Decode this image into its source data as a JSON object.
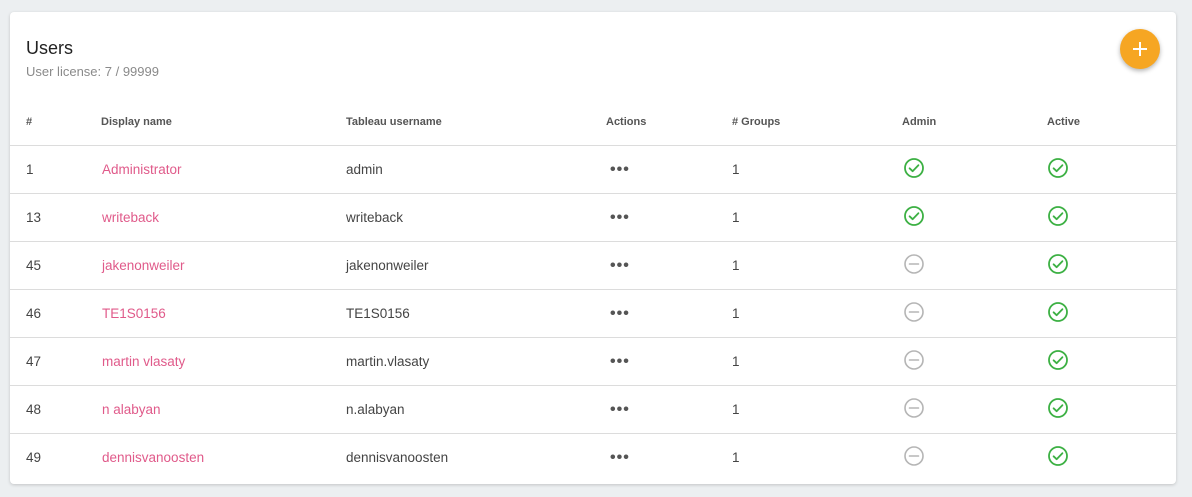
{
  "header": {
    "title": "Users",
    "license_text": "User license: 7 / 99999"
  },
  "columns": [
    "#",
    "Display name",
    "Tableau username",
    "Actions",
    "# Groups",
    "Admin",
    "Active"
  ],
  "rows": [
    {
      "id": "1",
      "display_name": "Administrator",
      "username": "admin",
      "actions": "•••",
      "groups": "1",
      "admin": true,
      "active": true
    },
    {
      "id": "13",
      "display_name": "writeback",
      "username": "writeback",
      "actions": "•••",
      "groups": "1",
      "admin": true,
      "active": true
    },
    {
      "id": "45",
      "display_name": "jakenonweiler",
      "username": "jakenonweiler",
      "actions": "•••",
      "groups": "1",
      "admin": false,
      "active": true
    },
    {
      "id": "46",
      "display_name": "TE1S0156",
      "username": "TE1S0156",
      "actions": "•••",
      "groups": "1",
      "admin": false,
      "active": true
    },
    {
      "id": "47",
      "display_name": "martin vlasaty",
      "username": "martin.vlasaty",
      "actions": "•••",
      "groups": "1",
      "admin": false,
      "active": true
    },
    {
      "id": "48",
      "display_name": "n alabyan",
      "username": "n.alabyan",
      "actions": "•••",
      "groups": "1",
      "admin": false,
      "active": true
    },
    {
      "id": "49",
      "display_name": "dennisvanoosten",
      "username": "dennisvanoosten",
      "actions": "•••",
      "groups": "1",
      "admin": false,
      "active": true
    }
  ],
  "icons": {
    "add": "plus-icon",
    "yes": "check-circle-icon",
    "no": "minus-circle-icon",
    "actions": "more-horizontal-icon"
  },
  "colors": {
    "accent": "#f6a623",
    "link": "#e05a8a",
    "check": "#3cb043",
    "minus": "#b5b5b5"
  }
}
